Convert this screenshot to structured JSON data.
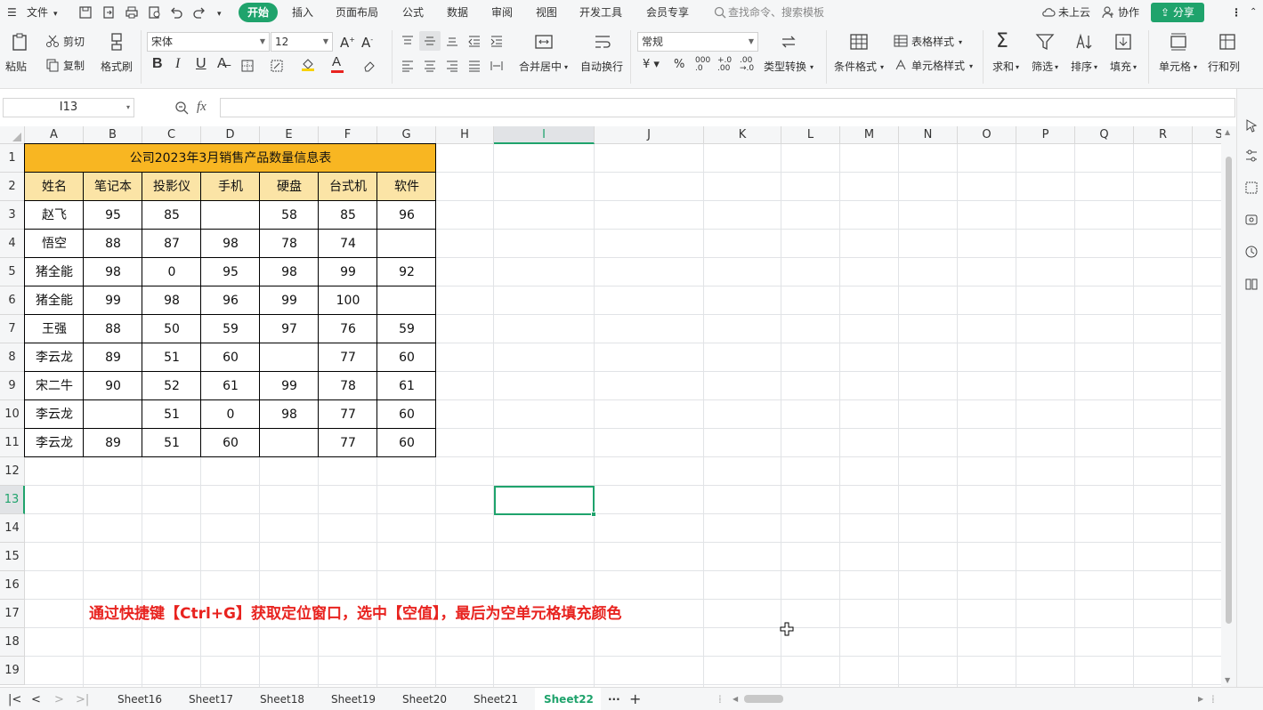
{
  "menu": {
    "file": "文件",
    "tabs": [
      "开始",
      "插入",
      "页面布局",
      "公式",
      "数据",
      "审阅",
      "视图",
      "开发工具",
      "会员专享"
    ],
    "search_placeholder": "查找命令、搜索模板",
    "cloud": "未上云",
    "collab": "协作",
    "share": "分享"
  },
  "ribbon": {
    "paste": "粘贴",
    "cut": "剪切",
    "copy": "复制",
    "format_painter": "格式刷",
    "font_name": "宋体",
    "font_size": "12",
    "merge_center": "合并居中",
    "wrap_text": "自动换行",
    "number_format": "常规",
    "type_convert": "类型转换",
    "cond_format": "条件格式",
    "table_style": "表格样式",
    "cell_style": "单元格样式",
    "sum": "求和",
    "filter": "筛选",
    "sort": "排序",
    "fill": "填充",
    "cell": "单元格",
    "row_col": "行和列"
  },
  "formula_bar": {
    "name_box": "I13",
    "fx": "fx",
    "value": ""
  },
  "columns": [
    "A",
    "B",
    "C",
    "D",
    "E",
    "F",
    "G",
    "H",
    "I",
    "J",
    "K",
    "L",
    "M",
    "N",
    "O",
    "P",
    "Q",
    "R",
    "S"
  ],
  "rows": [
    "1",
    "2",
    "3",
    "4",
    "5",
    "6",
    "7",
    "8",
    "9",
    "10",
    "11",
    "12",
    "13",
    "14",
    "15",
    "16",
    "17",
    "18",
    "19"
  ],
  "table": {
    "title": "公司2023年3月销售产品数量信息表",
    "headers": [
      "姓名",
      "笔记本",
      "投影仪",
      "手机",
      "硬盘",
      "台式机",
      "软件"
    ],
    "data": [
      [
        "赵飞",
        "95",
        "85",
        "",
        "58",
        "85",
        "96"
      ],
      [
        "悟空",
        "88",
        "87",
        "98",
        "78",
        "74",
        ""
      ],
      [
        "猪全能",
        "98",
        "0",
        "95",
        "98",
        "99",
        "92"
      ],
      [
        "猪全能",
        "99",
        "98",
        "96",
        "99",
        "100",
        ""
      ],
      [
        "王强",
        "88",
        "50",
        "59",
        "97",
        "76",
        "59"
      ],
      [
        "李云龙",
        "89",
        "51",
        "60",
        "",
        "77",
        "60"
      ],
      [
        "宋二牛",
        "90",
        "52",
        "61",
        "99",
        "78",
        "61"
      ],
      [
        "李云龙",
        "",
        "51",
        "0",
        "98",
        "77",
        "60"
      ],
      [
        "李云龙",
        "89",
        "51",
        "60",
        "",
        "77",
        "60"
      ]
    ],
    "header_color": "#fbe4a6",
    "title_color": "#f8b622"
  },
  "annotation": "通过快捷键【Ctrl+G】获取定位窗口，选中【空值】，最后为空单元格填充颜色",
  "sheets": [
    "Sheet16",
    "Sheet17",
    "Sheet18",
    "Sheet19",
    "Sheet20",
    "Sheet21",
    "Sheet22"
  ],
  "active_sheet": "Sheet22",
  "colors": {
    "accent": "#1fa36c",
    "annotation": "#e8231f"
  }
}
